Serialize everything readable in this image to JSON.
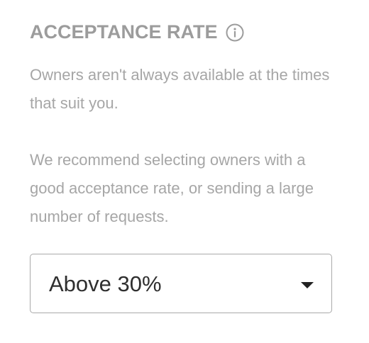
{
  "filter": {
    "title": "ACCEPTANCE RATE",
    "info_icon": "info-circle-icon",
    "paragraph1": "Owners aren't always available at the times that suit you.",
    "paragraph2": "We recommend selecting owners with a good acceptance rate, or sending a large number of requests.",
    "select": {
      "value": "Above 30%",
      "caret_icon": "caret-down-icon"
    }
  },
  "colors": {
    "title": "#9c9c9c",
    "body_text": "#a6a6a6",
    "select_border": "#a9a9a9",
    "select_text": "#2f2f2f",
    "caret": "#222222"
  }
}
